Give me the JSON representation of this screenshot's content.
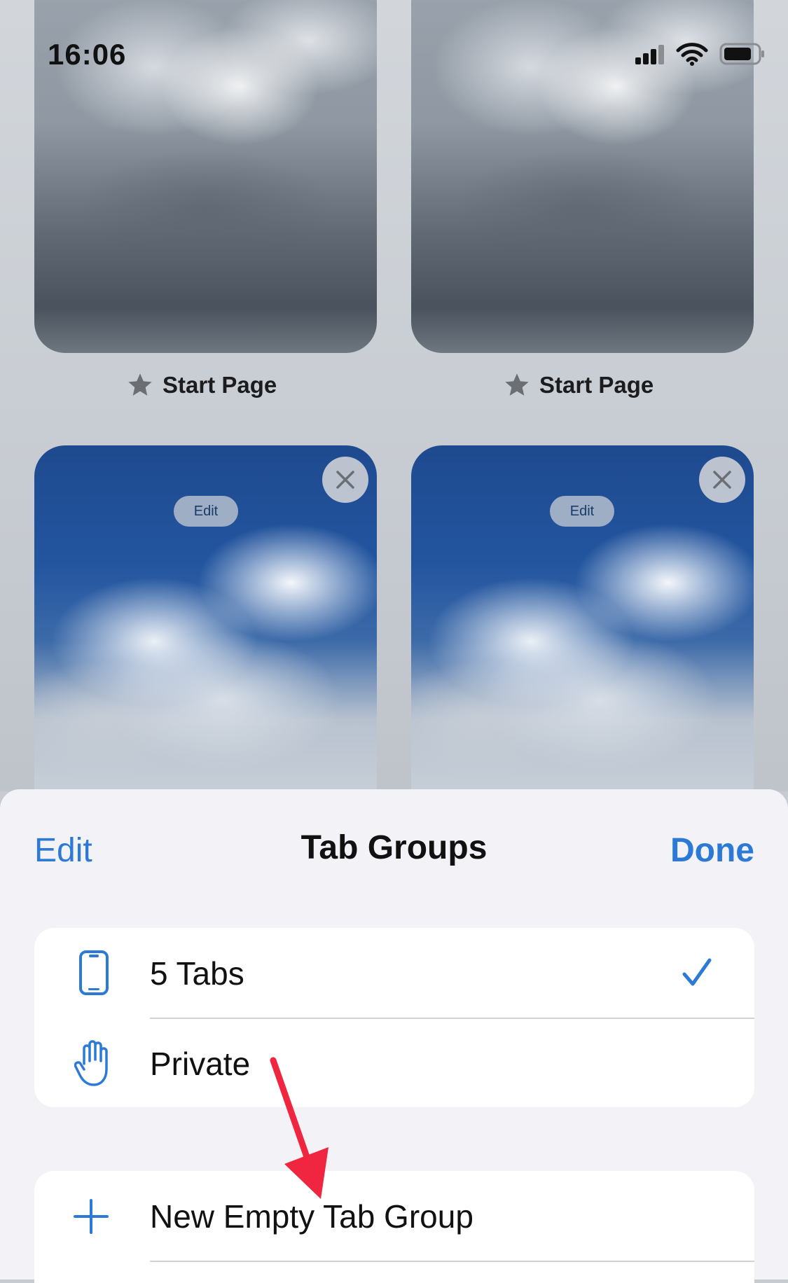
{
  "status_bar": {
    "time": "16:06"
  },
  "tabs": [
    {
      "label": "Start Page"
    },
    {
      "label": "Start Page"
    },
    {
      "edit_label": "Edit"
    },
    {
      "edit_label": "Edit"
    }
  ],
  "sheet": {
    "edit_label": "Edit",
    "title": "Tab Groups",
    "done_label": "Done",
    "groups": [
      {
        "label": "5 Tabs",
        "icon": "phone-icon",
        "selected": true
      },
      {
        "label": "Private",
        "icon": "hand-icon",
        "selected": false
      }
    ],
    "new_group_label": "New Empty Tab Group"
  },
  "colors": {
    "accent": "#2d7ad6",
    "annotation_arrow": "#f0253f"
  }
}
